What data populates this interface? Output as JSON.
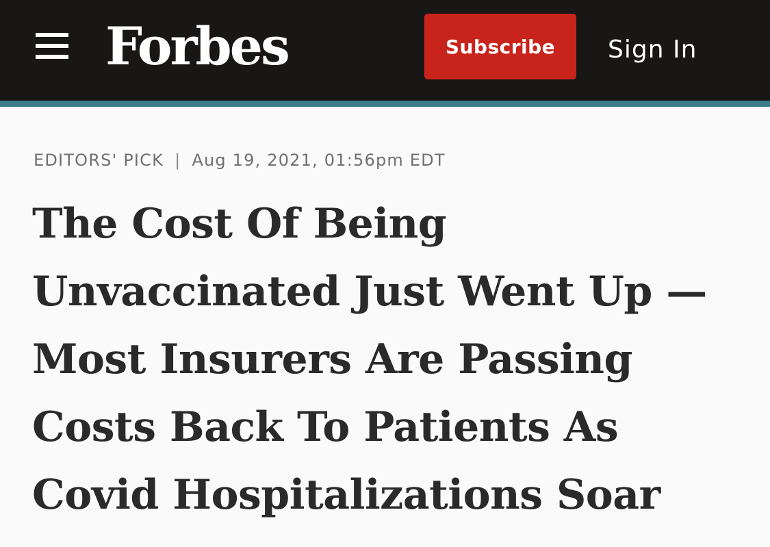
{
  "colors": {
    "header_background": "#181716",
    "accent_line": "#3a7d8a",
    "subscribe_background": "#c9241c",
    "page_background": "#fafafa",
    "headline_text": "#2a2a2a",
    "meta_text": "#707070"
  },
  "header": {
    "menu_icon": "hamburger-icon",
    "logo_text": "Forbes",
    "subscribe_label": "Subscribe",
    "signin_label": "Sign In"
  },
  "article": {
    "category": "EDITORS' PICK",
    "separator": "|",
    "timestamp": "Aug 19, 2021, 01:56pm EDT",
    "headline_lines": [
      "The Cost Of Being",
      "Unvaccinated Just Went Up —",
      "Most Insurers Are Passing",
      "Costs Back To Patients As",
      "Covid Hospitalizations Soar"
    ]
  }
}
